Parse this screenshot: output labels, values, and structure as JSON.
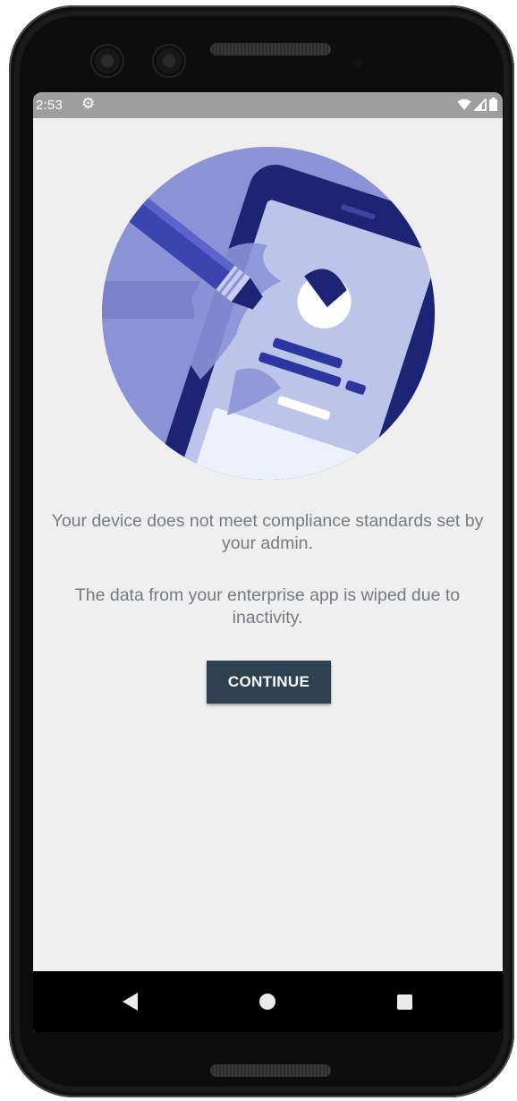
{
  "status_bar": {
    "time": "2:53",
    "settings_icon": "gear-icon",
    "wifi_icon": "wifi-icon",
    "signal_icon": "cell-signal-icon",
    "battery_icon": "battery-icon"
  },
  "illustration": {
    "icon": "device-compliance-illustration",
    "circle_color": "#8a93d6",
    "device_color": "#1c2575"
  },
  "content": {
    "message_compliance": "Your device does not meet compliance standards set by your admin.",
    "message_wipe": "The data from your enterprise app is wiped due to inactivity.",
    "continue_label": "CONTINUE"
  },
  "nav_bar": {
    "back_icon": "back-triangle-icon",
    "home_icon": "home-circle-icon",
    "recents_icon": "recents-square-icon"
  },
  "colors": {
    "screen_background": "#efefef",
    "status_bar": "#9e9e9e",
    "button": "#2e4150",
    "message_text": "#757b83"
  }
}
